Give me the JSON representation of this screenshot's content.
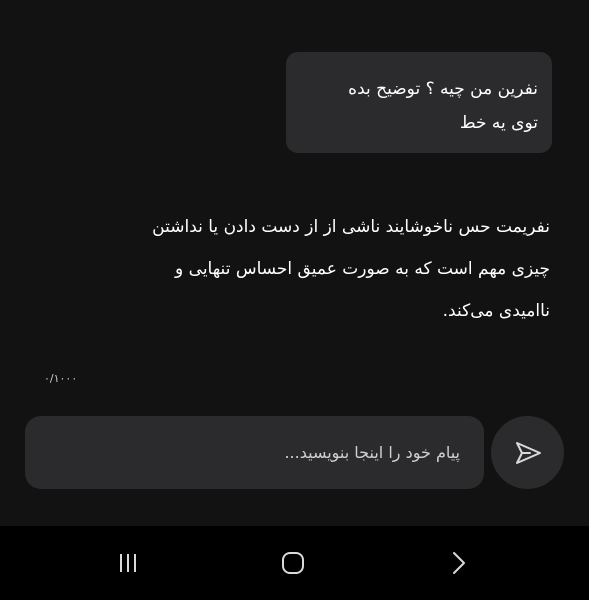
{
  "conversation": {
    "user_message_line1": "نفرین من چیه ؟ توضیح بده",
    "user_message_line2": "توی یه خط",
    "reply_line1": "نفریمت حس ناخوشایند ناشی از از دست دادن یا نداشتن",
    "reply_line2": "چیزی مهم است که به صورت عمیق احساس تنهایی و",
    "reply_line3": "ناامیدی می‌کند."
  },
  "composer": {
    "char_counter": "۰/۱۰۰۰",
    "placeholder": "پیام خود را اینجا بنویسید...",
    "value": ""
  },
  "icons": {
    "send": "send-icon",
    "recents": "recents-icon",
    "home": "home-icon",
    "back": "back-icon"
  },
  "colors": {
    "background": "#121212",
    "bubble": "#2b2b2d",
    "text": "#ffffff",
    "muted": "#cfcfcf",
    "icon": "#d9d9d9"
  }
}
